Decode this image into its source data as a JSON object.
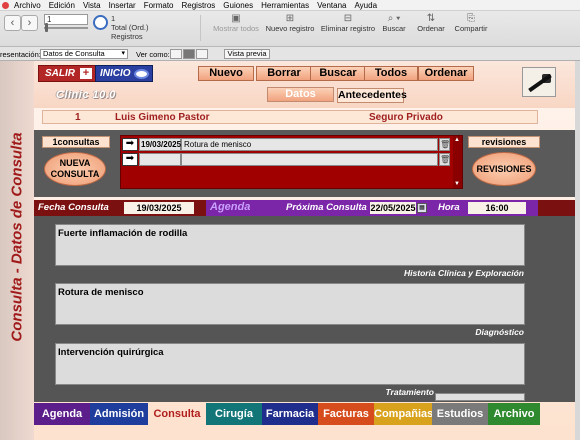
{
  "menubar": {
    "items": [
      "Archivo",
      "Edición",
      "Vista",
      "Insertar",
      "Formato",
      "Registros",
      "Guiones",
      "Herramientas",
      "Ventana",
      "Ayuda"
    ]
  },
  "toolbar": {
    "prev_icon": "chevron-left-icon",
    "next_icon": "chevron-right-icon",
    "record_number": "1",
    "found_count": "1",
    "total_text": "Total (Ord.)",
    "records_label": "Registros",
    "show_all": "Mostrar todos",
    "new_record": "Nuevo registro",
    "delete_record": "Eliminar registro",
    "find": "Buscar",
    "sort": "Ordenar",
    "share": "Compartir"
  },
  "layoutbar": {
    "presentation_label": "resentación:",
    "layout_value": "Datos de Consulta",
    "view_as_label": "Ver como:",
    "preview_label": "Vista previa"
  },
  "sidebar": {
    "title": "Consulta - Datos de Consulta"
  },
  "header": {
    "salir": "SALIR",
    "inicio": "INICIO",
    "clinic_name": "Clinic 10.0",
    "buttons": [
      "Nuevo",
      "Borrar",
      "Buscar",
      "Todos",
      "Ordenar"
    ],
    "tab_datos": "Datos",
    "tab_antecedentes": "Antecedentes"
  },
  "patient": {
    "number": "1",
    "name": "Luis Gimeno Pastor",
    "insurance": "Seguro Privado"
  },
  "consultas": {
    "count_label": "1consultas",
    "new_button": "NUEVA CONSULTA",
    "revisiones_label": "revisiones",
    "revisiones_button": "REVISIONES",
    "rows": [
      {
        "date": "19/03/2025",
        "text": "Rotura de menisco"
      },
      {
        "date": "",
        "text": ""
      }
    ]
  },
  "consulta_bar": {
    "fecha_label": "Fecha Consulta",
    "fecha_value": "19/03/2025",
    "agenda_label": "Agenda",
    "proxima_label": "Próxima Consulta",
    "proxima_value": "22/05/2025",
    "hora_label": "Hora",
    "hora_value": "16:00"
  },
  "fields": {
    "historia_text": "Fuerte inflamación de rodilla",
    "historia_label": "Historia Clínica y Exploración",
    "diagnostico_text": "Rotura de menisco",
    "diagnostico_label": "Diagnóstico",
    "tratamiento_text": "Intervención quirúrgica",
    "tratamiento_label": "Tratamiento"
  },
  "tabs": [
    {
      "label": "Agenda",
      "bg": "#5b1e8a",
      "fg": "#ffffff"
    },
    {
      "label": "Admisión",
      "bg": "#1f3d9c",
      "fg": "#ffffff"
    },
    {
      "label": "Consulta",
      "bg": "#fde3cf",
      "fg": "#b01e1e"
    },
    {
      "label": "Cirugía",
      "bg": "#127678",
      "fg": "#ffffff"
    },
    {
      "label": "Farmacia",
      "bg": "#1f2d8c",
      "fg": "#ffffff"
    },
    {
      "label": "Facturas",
      "bg": "#d64c1c",
      "fg": "#ffffff"
    },
    {
      "label": "Compañias",
      "bg": "#d9a21c",
      "fg": "#ffffff"
    },
    {
      "label": "Estudios",
      "bg": "#7a7a7a",
      "fg": "#ffffff"
    },
    {
      "label": "Archivo",
      "bg": "#2f8a2f",
      "fg": "#ffffff"
    }
  ]
}
